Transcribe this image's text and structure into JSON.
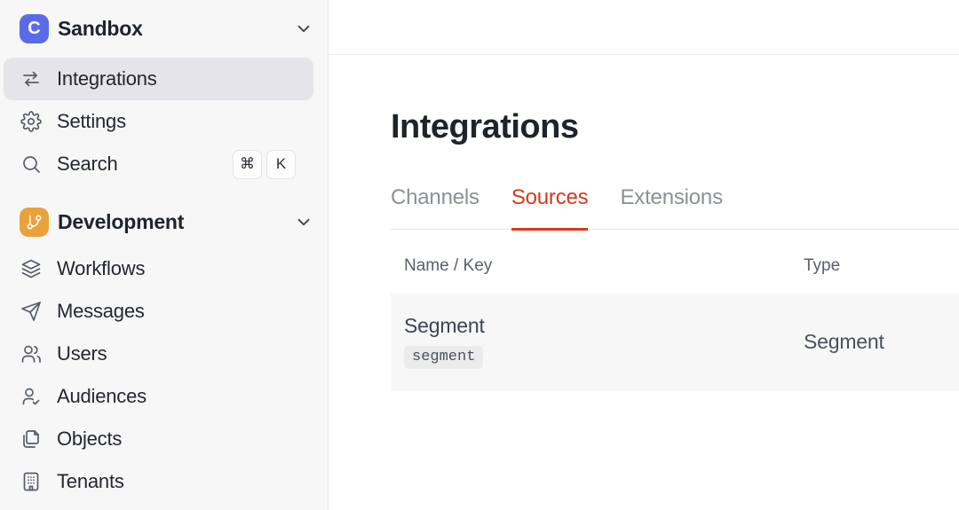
{
  "sidebar": {
    "workspace": {
      "logo_letter": "C",
      "name": "Sandbox",
      "logo_icon": "courier-logo",
      "chevron_icon": "chevron-down-icon"
    },
    "items": [
      {
        "label": "Integrations",
        "icon": "swap-arrows-icon",
        "selected": true
      },
      {
        "label": "Settings",
        "icon": "gear-icon",
        "selected": false
      },
      {
        "label": "Search",
        "icon": "search-icon",
        "selected": false
      }
    ],
    "search_shortcut": [
      "⌘",
      "K"
    ],
    "development": {
      "label": "Development",
      "icon": "git-branch-icon",
      "chevron_icon": "chevron-down-icon"
    },
    "dev_items": [
      {
        "label": "Workflows",
        "icon": "layers-icon"
      },
      {
        "label": "Messages",
        "icon": "paper-plane-icon"
      },
      {
        "label": "Users",
        "icon": "users-icon"
      },
      {
        "label": "Audiences",
        "icon": "user-check-icon"
      },
      {
        "label": "Objects",
        "icon": "copy-icon"
      },
      {
        "label": "Tenants",
        "icon": "building-icon"
      }
    ]
  },
  "main": {
    "title": "Integrations",
    "tabs": [
      {
        "label": "Channels",
        "active": false
      },
      {
        "label": "Sources",
        "active": true
      },
      {
        "label": "Extensions",
        "active": false
      }
    ],
    "table": {
      "columns": [
        "Name / Key",
        "Type"
      ],
      "rows": [
        {
          "name": "Segment",
          "key": "segment",
          "type": "Segment"
        }
      ]
    }
  },
  "colors": {
    "accent_red": "#D7391D",
    "logo_indigo": "#5B6BE8",
    "development_orange": "#E9A23B",
    "sidebar_bg": "#F7F7F8",
    "selected_item_bg": "#E4E4E9",
    "row_bg": "#F7F7F8"
  }
}
